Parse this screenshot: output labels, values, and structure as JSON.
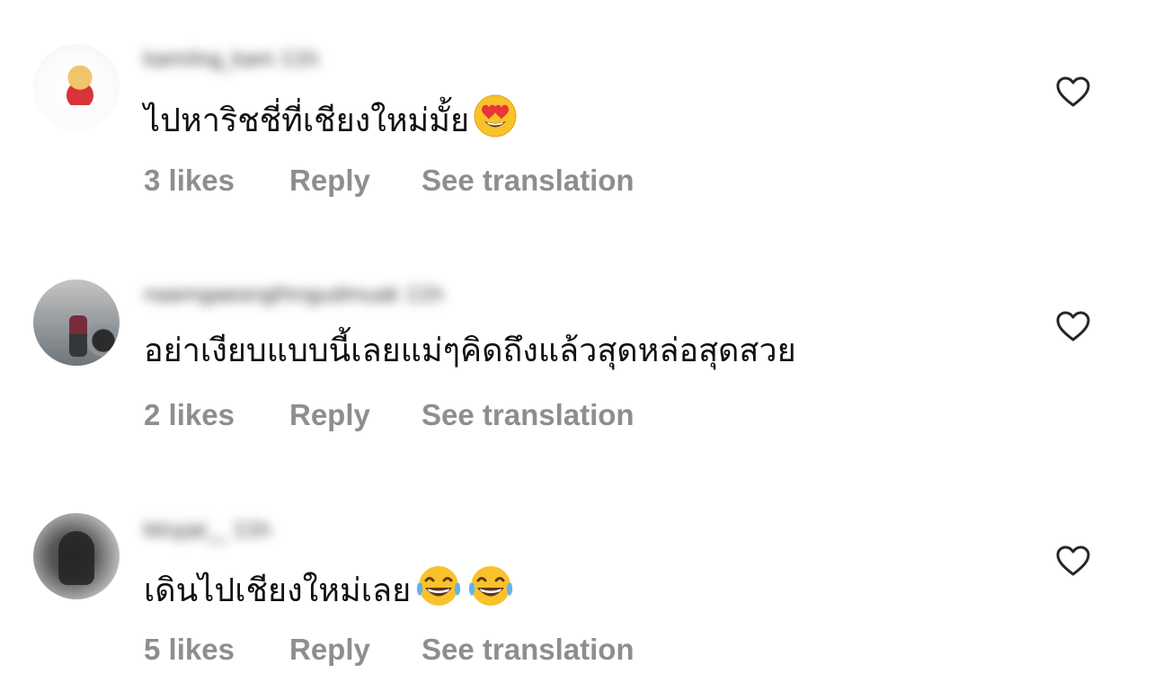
{
  "comments": [
    {
      "username": "kamilng_kam 11h",
      "text": "ไปหาริชชี่ที่เชียงใหม่มั้ย",
      "emojis": [
        "heart-eyes"
      ],
      "likes": "3 likes",
      "reply": "Reply",
      "see_translation": "See translation"
    },
    {
      "username": "naamgaeongthngudmuak 11h",
      "text": "อย่าเงียบแบบนี้เลยแม่ๆคิดถึงแล้วสุดหล่อสุดสวย",
      "emojis": [],
      "likes": "2 likes",
      "reply": "Reply",
      "see_translation": "See translation"
    },
    {
      "username": "kkiyjai__ 11h",
      "text": "เดินไปเชียงใหม่เลย",
      "emojis": [
        "tears-of-joy",
        "tears-of-joy"
      ],
      "likes": "5 likes",
      "reply": "Reply",
      "see_translation": "See translation"
    }
  ],
  "icons": {
    "like": "heart-outline-icon"
  },
  "colors": {
    "meta_text": "#8e8e8e",
    "comment_text": "#111111",
    "background": "#ffffff"
  }
}
